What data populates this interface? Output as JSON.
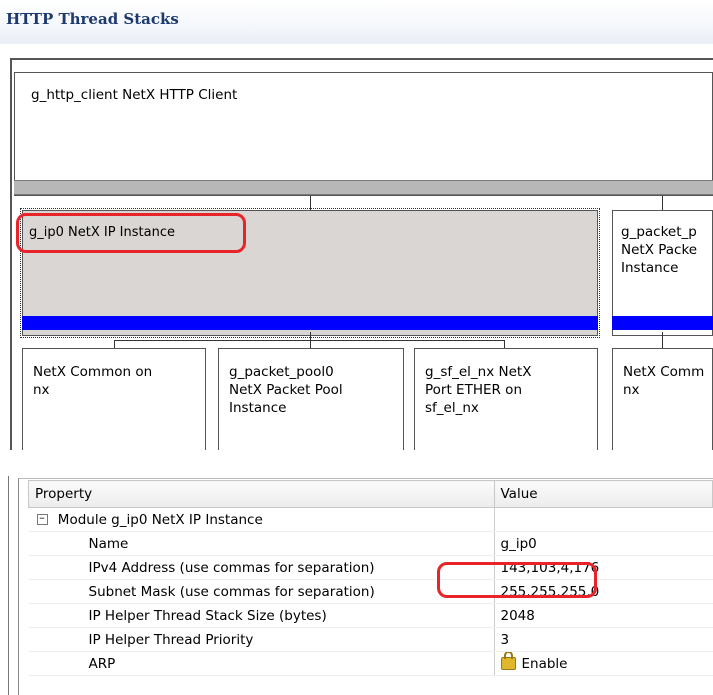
{
  "title": "HTTP Thread Stacks",
  "stacks": {
    "client": "g_http_client NetX HTTP Client",
    "ip": "g_ip0 NetX IP Instance",
    "packet_pool_partial": "g_packet_p\nNetX Packe\nInstance",
    "leaves": [
      "NetX Common on\nnx",
      "g_packet_pool0\nNetX Packet Pool\nInstance",
      "g_sf_el_nx NetX\nPort ETHER on\nsf_el_nx",
      "NetX Comm\nnx"
    ]
  },
  "properties": {
    "header": {
      "property": "Property",
      "value": "Value"
    },
    "module_row": {
      "expander": "−",
      "label": "Module g_ip0 NetX IP Instance"
    },
    "rows": [
      {
        "label": "Name",
        "value": "g_ip0"
      },
      {
        "label": "IPv4 Address (use commas for separation)",
        "value": "143,103,4,176"
      },
      {
        "label": "Subnet Mask (use commas for separation)",
        "value": "255,255,255,0"
      },
      {
        "label": "IP Helper Thread Stack Size (bytes)",
        "value": "2048"
      },
      {
        "label": "IP Helper Thread Priority",
        "value": "3"
      },
      {
        "label": "ARP",
        "value": "Enable",
        "icon": "lock-icon"
      }
    ]
  },
  "colors": {
    "highlight": "#e8242a",
    "blue_bar": "#0000ff",
    "title": "#1c3a6e"
  }
}
